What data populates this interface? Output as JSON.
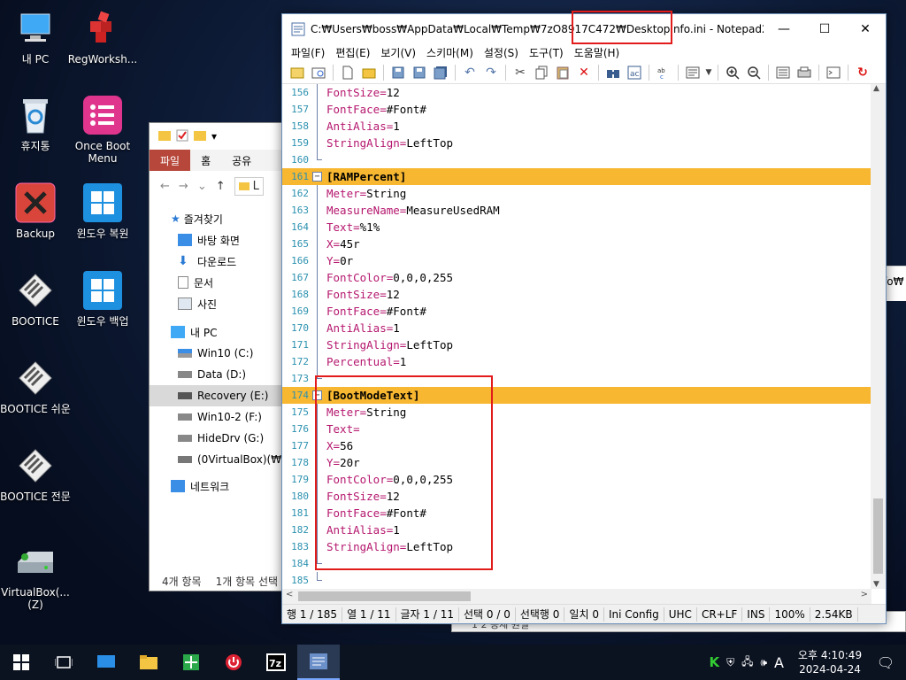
{
  "desktop": {
    "icons": [
      {
        "label": "내 PC"
      },
      {
        "label": "RegWorksh..."
      },
      {
        "label": "휴지통"
      },
      {
        "label": "Once Boot Menu"
      },
      {
        "label": "Backup"
      },
      {
        "label": "윈도우 복원"
      },
      {
        "label": "BOOTICE"
      },
      {
        "label": "윈도우 백업"
      },
      {
        "label": "BOOTICE 쉬운"
      },
      {
        "label": "BOOTICE 전문"
      },
      {
        "label": "VirtualBox(... (Z)"
      }
    ]
  },
  "explorer": {
    "tabs": [
      "파일",
      "홈",
      "공유"
    ],
    "address_partial": "L",
    "nav": {
      "quick_access": "즐겨찾기",
      "pinned": [
        "바탕 화면",
        "다운로드",
        "문서",
        "사진"
      ],
      "this_pc": "내 PC",
      "drives": [
        "Win10 (C:)",
        "Data (D:)",
        "Recovery (E:)",
        "Win10-2 (F:)",
        "HideDrv (G:)",
        "(0VirtualBox)(₩₩V"
      ],
      "network": "네트워크"
    },
    "status_items": "4개 항목",
    "status_selected": "1개 항목 선택"
  },
  "behind_window": {
    "text": "fo₩"
  },
  "behind_status": {
    "text": "1 2 승제 원렬"
  },
  "notepad": {
    "title": "C:₩Users₩boss₩AppData₩Local₩Temp₩7zO8917C472₩DesktopInfo.ini - Notepad2",
    "menu": [
      "파일(F)",
      "편집(E)",
      "보기(V)",
      "스키마(M)",
      "설정(S)",
      "도구(T)",
      "도움말(H)"
    ],
    "lines": [
      {
        "n": "156",
        "k": "FontSize",
        "v": "12"
      },
      {
        "n": "157",
        "k": "FontFace",
        "v": "#Font#"
      },
      {
        "n": "158",
        "k": "AntiAlias",
        "v": "1"
      },
      {
        "n": "159",
        "k": "StringAlign",
        "v": "LeftTop"
      },
      {
        "n": "160",
        "k": "",
        "v": ""
      },
      {
        "n": "161",
        "sec": "[RAMPercent]"
      },
      {
        "n": "162",
        "k": "Meter",
        "v": "String"
      },
      {
        "n": "163",
        "k": "MeasureName",
        "v": "MeasureUsedRAM"
      },
      {
        "n": "164",
        "k": "Text",
        "v": "%1%"
      },
      {
        "n": "165",
        "k": "X",
        "v": "45r"
      },
      {
        "n": "166",
        "k": "Y",
        "v": "0r"
      },
      {
        "n": "167",
        "k": "FontColor",
        "v": "0,0,0,255"
      },
      {
        "n": "168",
        "k": "FontSize",
        "v": "12"
      },
      {
        "n": "169",
        "k": "FontFace",
        "v": "#Font#"
      },
      {
        "n": "170",
        "k": "AntiAlias",
        "v": "1"
      },
      {
        "n": "171",
        "k": "StringAlign",
        "v": "LeftTop"
      },
      {
        "n": "172",
        "k": "Percentual",
        "v": "1"
      },
      {
        "n": "173",
        "k": "",
        "v": ""
      },
      {
        "n": "174",
        "sec": "[BootModeText]"
      },
      {
        "n": "175",
        "k": "Meter",
        "v": "String"
      },
      {
        "n": "176",
        "k": "Text",
        "v": ""
      },
      {
        "n": "177",
        "k": "X",
        "v": "56"
      },
      {
        "n": "178",
        "k": "Y",
        "v": "20r"
      },
      {
        "n": "179",
        "k": "FontColor",
        "v": "0,0,0,255"
      },
      {
        "n": "180",
        "k": "FontSize",
        "v": "12"
      },
      {
        "n": "181",
        "k": "FontFace",
        "v": "#Font#"
      },
      {
        "n": "182",
        "k": "AntiAlias",
        "v": "1"
      },
      {
        "n": "183",
        "k": "StringAlign",
        "v": "LeftTop"
      },
      {
        "n": "184",
        "k": "",
        "v": ""
      },
      {
        "n": "185",
        "k": "",
        "v": ""
      }
    ],
    "status": [
      "행 1 / 185",
      "열 1 / 11",
      "글자 1 / 11",
      "선택 0 / 0",
      "선택행 0",
      "일치 0",
      "Ini Config",
      "UHC",
      "CR+LF",
      "INS",
      "100%",
      "2.54KB"
    ]
  },
  "taskbar": {
    "time": "오후 4:10:49",
    "date": "2024-04-24",
    "ime": "A"
  },
  "colors": {
    "highlight": "#f7b731",
    "key": "#b5176e",
    "annotation": "#e21b1b"
  }
}
